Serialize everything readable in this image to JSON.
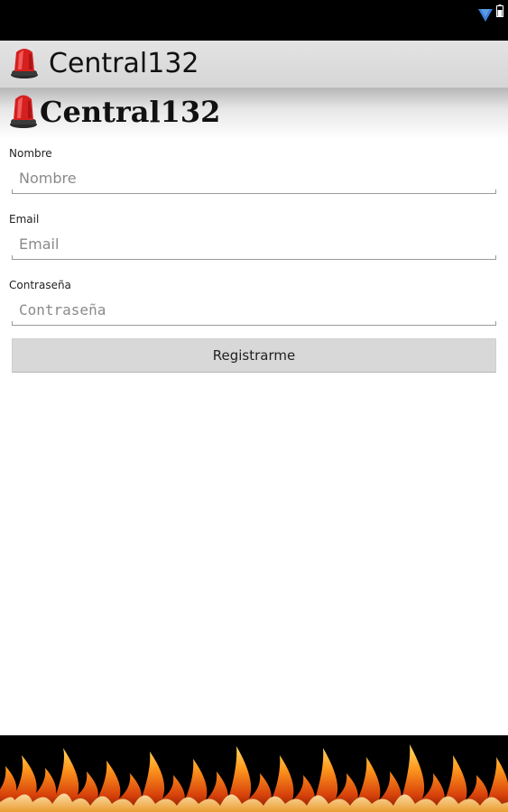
{
  "status_bar": {
    "icons": [
      "wifi-icon",
      "battery-icon"
    ]
  },
  "action_bar": {
    "title": "Central132",
    "icon": "siren-icon"
  },
  "banner": {
    "logo_text": "Central132",
    "icon": "siren-icon"
  },
  "form": {
    "fields": [
      {
        "label": "Nombre",
        "placeholder": "Nombre",
        "value": ""
      },
      {
        "label": "Email",
        "placeholder": "Email",
        "value": ""
      },
      {
        "label": "Contraseña",
        "placeholder": "Contraseña",
        "value": ""
      }
    ],
    "submit_label": "Registrarme"
  },
  "footer": {
    "image": "fire-flames"
  },
  "colors": {
    "status_bar": "#000000",
    "action_bar": "#dcdcdc",
    "wifi": "#3a7fd5",
    "siren_red": "#d61f1f",
    "button": "#d8d8d8"
  }
}
